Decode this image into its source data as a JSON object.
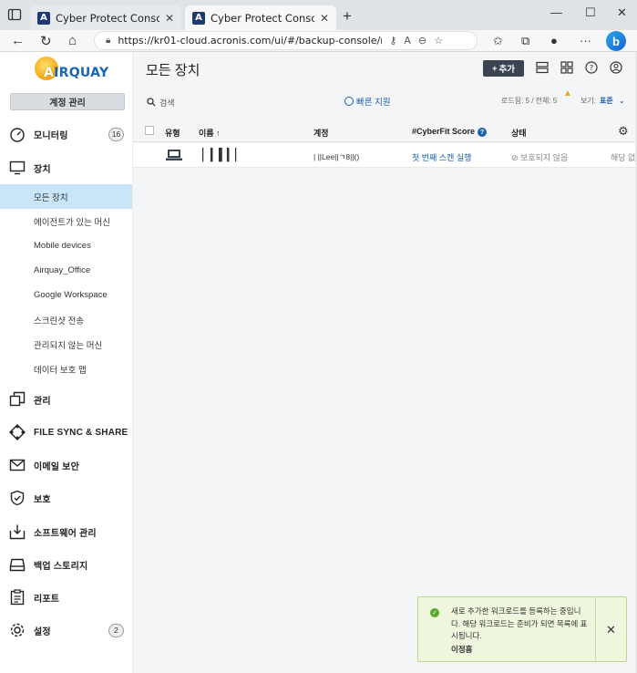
{
  "browser": {
    "tabs": [
      {
        "title": "Cyber Protect Console",
        "favicon": "A"
      },
      {
        "title": "Cyber Protect Console",
        "favicon": "A"
      }
    ],
    "url": "https://kr01-cloud.acronis.com/ui/#/backup-console/resources/..."
  },
  "sidebar": {
    "logo_text": "IRQUAY",
    "logo_letter": "A",
    "account_button": "계정 관리",
    "items": [
      {
        "label": "모니터링",
        "icon": "speedometer-icon",
        "badge": "16"
      },
      {
        "label": "장치",
        "icon": "monitor-icon"
      },
      {
        "label": "관리",
        "icon": "copy-icon"
      },
      {
        "label": "FILE SYNC & SHARE",
        "icon": "sync-share-icon"
      },
      {
        "label": "이메일 보안",
        "icon": "envelope-icon"
      },
      {
        "label": "보호",
        "icon": "shield-check-icon"
      },
      {
        "label": "소프트웨어 관리",
        "icon": "download-box-icon"
      },
      {
        "label": "백업 스토리지",
        "icon": "storage-icon"
      },
      {
        "label": "리포트",
        "icon": "clipboard-icon"
      },
      {
        "label": "설정",
        "icon": "gear-icon",
        "badge": "2"
      }
    ],
    "sub_items": [
      "모든 장치",
      "에이전트가 있는 머신",
      "Mobile devices",
      "Airquay_Office",
      "Google Workspace",
      "스크린샷 전송",
      "관리되지 않는 머신",
      "데이터 보호 맵"
    ]
  },
  "main": {
    "title": "모든 장치",
    "add_button": "추가",
    "search_label": "검색",
    "quick_support": "빠른 지원",
    "loaded_text": "로드됨: 5 / 전체: 5",
    "view_label": "보기:",
    "view_value": "표준",
    "columns": [
      "유형",
      "이름 ↑",
      "계정",
      "#CyberFit Score",
      "상태"
    ],
    "rows": [
      {
        "name": "▏▎▍▎▏",
        "account": "| ||Lee||ㄱ8||()",
        "cyberfit": "첫 번째 스캔 실행",
        "status": "보호되지 않음",
        "extra": "해당 없"
      }
    ]
  },
  "toast": {
    "message": "새로 추가한 워크로드를 등록하는 중입니다. 해당 워크로드는 준비가 되면 목록에 표시됩니다.",
    "user": "이정흠"
  },
  "colors": {
    "accent": "#1a5fae",
    "active_nav": "#c9e6f8",
    "add_button": "#3b4552",
    "toast_bg": "#eef6dd",
    "success": "#5aa830"
  }
}
